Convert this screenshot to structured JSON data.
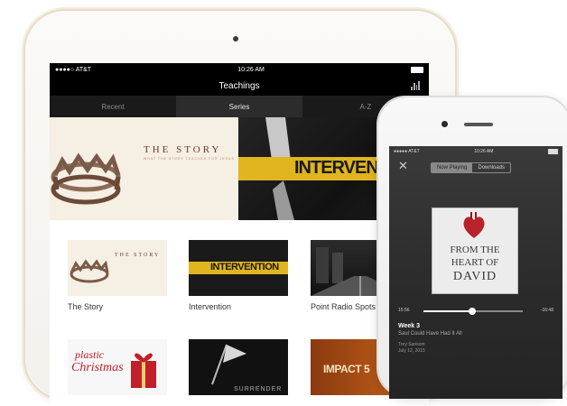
{
  "ipad": {
    "status": {
      "carrier": "●●●●○ AT&T",
      "time": "10:26 AM"
    },
    "nav_title": "Teachings",
    "tabs": [
      {
        "label": "Recent",
        "active": false
      },
      {
        "label": "Series",
        "active": true
      },
      {
        "label": "A-Z",
        "active": false
      }
    ],
    "hero": {
      "story_title": "THE STORY",
      "story_subtitle": "WHAT THE STORY TEACHES FOR JESUS",
      "intervention_word": "INTERVENTION"
    },
    "series": [
      {
        "label": "The Story",
        "art_text": "THE STORY"
      },
      {
        "label": "Intervention",
        "art_text": "INTERVENTION"
      },
      {
        "label": "Point Radio Spots",
        "art_text": ""
      },
      {
        "label": "",
        "art_text_1": "plastic",
        "art_text_2": "Christmas"
      },
      {
        "label": "",
        "art_text": "SURRENDER"
      },
      {
        "label": "",
        "art_text": "IMPACT 5"
      }
    ],
    "colors": {
      "accent_gold": "#e0b51f",
      "bar": "#000000"
    }
  },
  "iphone": {
    "status": {
      "carrier": "●●●●● AT&T",
      "time": "10:26 AM"
    },
    "close_icon": "close-icon",
    "segments": [
      {
        "label": "Now Playing",
        "active": true
      },
      {
        "label": "Downloads",
        "active": false
      }
    ],
    "artwork": {
      "line1": "FROM THE",
      "line2": "HEART OF",
      "line3": "DAVID"
    },
    "playback": {
      "elapsed": "15:56",
      "remaining": "-16:48",
      "progress": 0.49
    },
    "track": {
      "week": "Week 3",
      "title": "Saul Could Have Had It All",
      "speaker": "Trey Sansom",
      "date": "July 12, 2015"
    }
  }
}
